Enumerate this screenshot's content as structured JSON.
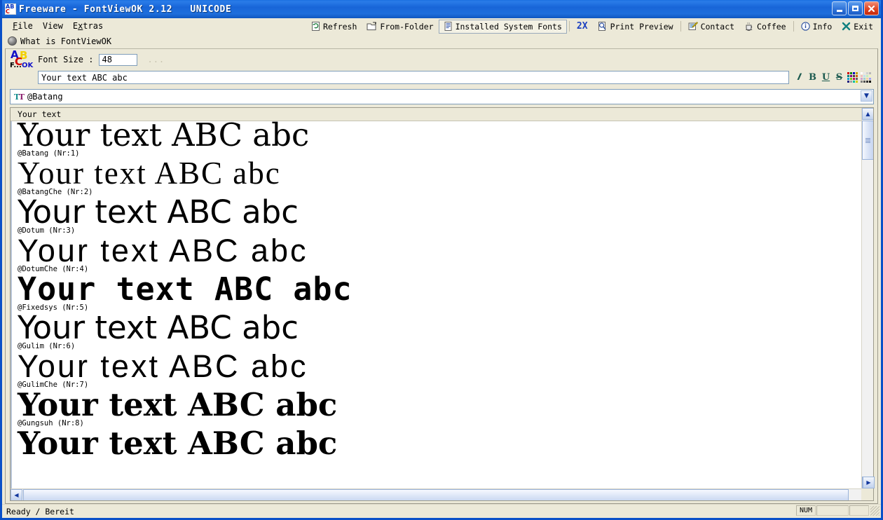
{
  "window": {
    "title": "Freeware - FontViewOK 2.12   UNICODE",
    "icon": "abc-app-icon",
    "minimize_label": "Minimize",
    "maximize_label": "Maximize",
    "close_label": "Close"
  },
  "menu": {
    "items": [
      {
        "label": "File",
        "accel": "F"
      },
      {
        "label": "View",
        "accel": "V"
      },
      {
        "label": "Extras",
        "accel": "x"
      }
    ]
  },
  "toolbar": {
    "items": [
      {
        "label": "Refresh",
        "icon": "refresh-icon",
        "active": false
      },
      {
        "label": "From-Folder",
        "icon": "folder-open-icon",
        "active": false
      },
      {
        "label": "Installed System Fonts",
        "icon": "font-list-icon",
        "active": true
      },
      {
        "label": "2X",
        "icon": "zoom-2x-icon",
        "active": false
      },
      {
        "label": "Print Preview",
        "icon": "print-preview-icon",
        "active": false
      },
      {
        "label": "Contact",
        "icon": "contact-icon",
        "active": false
      },
      {
        "label": "Coffee",
        "icon": "coffee-icon",
        "active": false
      },
      {
        "label": "Info",
        "icon": "info-icon",
        "active": false
      },
      {
        "label": "Exit",
        "icon": "exit-x-icon",
        "active": false
      }
    ]
  },
  "whatis": {
    "label": "What is FontViewOK",
    "icon": "globe-icon"
  },
  "controls": {
    "logo": {
      "a": "A",
      "b": "B",
      "c": "C",
      "f": "F...",
      "ok": "OK"
    },
    "font_size_label": "Font Size :",
    "font_size_value": "48",
    "dots_label": "...",
    "sample_text_value": "Your text ABC abc",
    "sample_text_placeholder": "Your text ABC abc",
    "format_buttons": [
      {
        "label": "I",
        "name": "italic-button"
      },
      {
        "label": "B",
        "name": "bold-button"
      },
      {
        "label": "U",
        "name": "underline-button"
      },
      {
        "label": "S",
        "name": "strikethrough-button"
      },
      {
        "label": "",
        "name": "text-color-button"
      },
      {
        "label": "",
        "name": "background-color-button"
      }
    ]
  },
  "font_combo": {
    "selected": "@Batang",
    "icon": "truetype-icon",
    "arrow": "▼"
  },
  "list": {
    "column_header": "Your text",
    "rows": [
      {
        "sample": "Your text ABC abc",
        "name": "@Batang (Nr:1)",
        "style": "f-serif"
      },
      {
        "sample": "Your text ABC abc",
        "name": "@BatangChe (Nr:2)",
        "style": "f-serif2"
      },
      {
        "sample": "Your text ABC abc",
        "name": "@Dotum (Nr:3)",
        "style": "f-sans"
      },
      {
        "sample": "Your text ABC abc",
        "name": "@DotumChe (Nr:4)",
        "style": "f-sans2"
      },
      {
        "sample": "Your text ABC abc",
        "name": "@Fixedsys (Nr:5)",
        "style": "f-fixed"
      },
      {
        "sample": "Your text ABC abc",
        "name": "@Gulim (Nr:6)",
        "style": "f-sans"
      },
      {
        "sample": "Your text ABC abc",
        "name": "@GulimChe (Nr:7)",
        "style": "f-sans2"
      },
      {
        "sample": "Your text ABC abc",
        "name": "@Gungsuh (Nr:8)",
        "style": "f-slab"
      },
      {
        "sample": "Your text ABC abc",
        "name": "",
        "style": "f-slab"
      }
    ]
  },
  "scrollbars": {
    "up_arrow": "▲",
    "down_arrow": "▼",
    "left_arrow": "‹",
    "right_arrow": "›"
  },
  "statusbar": {
    "message": "Ready / Bereit",
    "num_indicator": "NUM"
  },
  "colors": {
    "titlebar_blue": "#1865d8",
    "window_face": "#ece9d8",
    "accent_blue": "#1a3fc0",
    "logo_blue": "#1010c8",
    "logo_yellow": "#f2d000",
    "logo_red": "#d00000",
    "close_red": "#df4422"
  }
}
